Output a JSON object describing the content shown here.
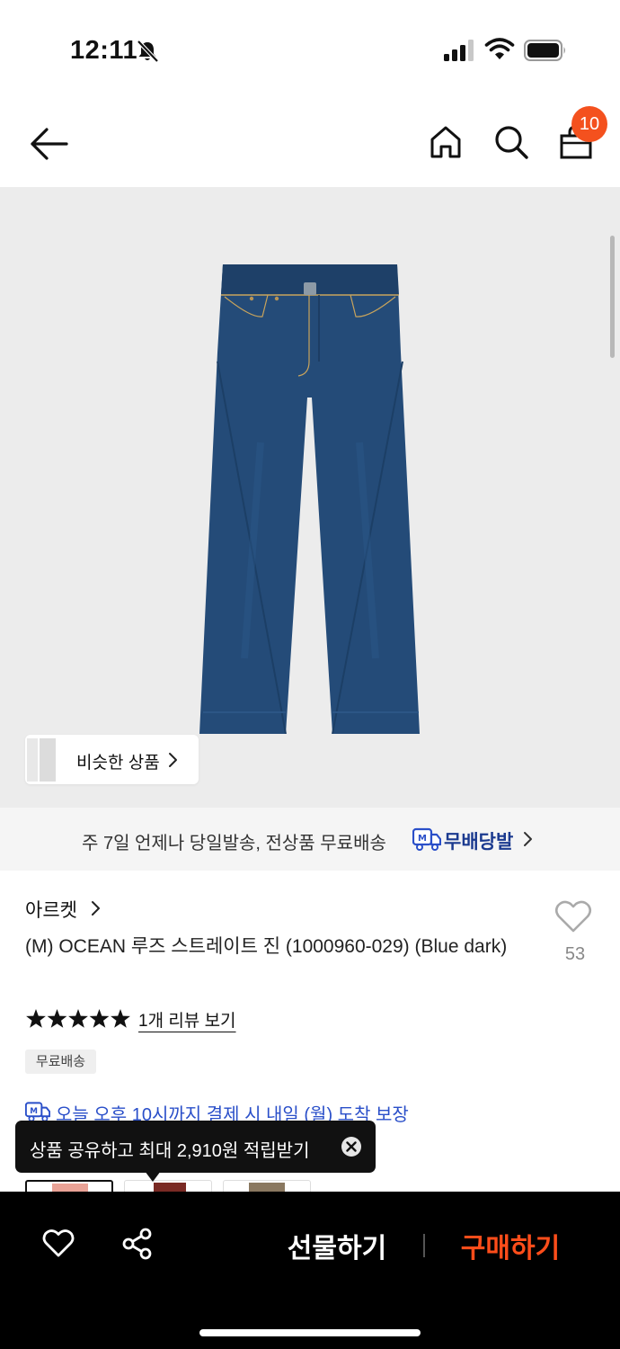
{
  "status_bar": {
    "time": "12:11"
  },
  "header": {
    "cart_badge": "10"
  },
  "similar_products": {
    "label": "비슷한 상품"
  },
  "delivery_banner": {
    "text": "주 7일 언제나 당일발송, 전상품 무료배송",
    "brand": "무배당발"
  },
  "product": {
    "brand": "아르켓",
    "title": "(M) OCEAN 루즈 스트레이트 진 (1000960-029) (Blue dark)",
    "like_count": "53",
    "rating_stars": 5,
    "review_link": "1개 리뷰 보기",
    "shipping_tag": "무료배송",
    "arrival_text": "오늘 오후 10시까지 결제 시 내일 (월) 도착 보장"
  },
  "tooltip": {
    "text": "상품 공유하고 최대 2,910원 적립받기"
  },
  "bottom_bar": {
    "gift_label": "선물하기",
    "buy_label": "구매하기"
  },
  "colors": {
    "accent": "#f4511e",
    "buy": "#ff4d1a",
    "link_blue": "#2a4fc9",
    "brand_navy": "#1b3a8f"
  },
  "icons": [
    "bell-slash-icon",
    "signal-icon",
    "wifi-icon",
    "battery-icon",
    "back-arrow-icon",
    "home-icon",
    "search-icon",
    "shopping-bag-icon",
    "chevron-right-icon",
    "delivery-truck-icon",
    "heart-icon",
    "star-icon",
    "close-circle-icon",
    "share-icon"
  ]
}
